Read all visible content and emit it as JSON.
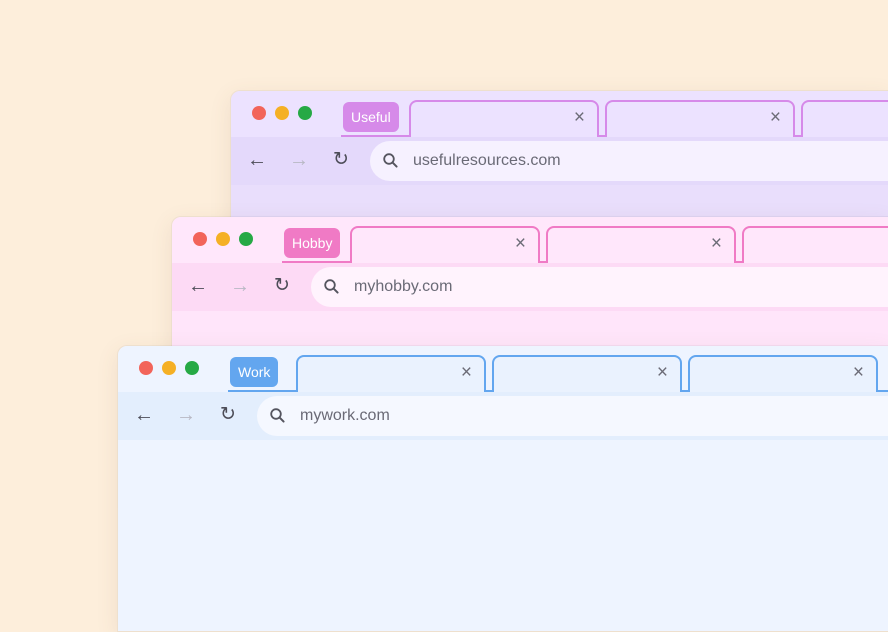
{
  "windows": {
    "useful": {
      "group_label": "Useful",
      "group_color": "#d68ae9",
      "url": "usefulresources.com",
      "tabs": [
        {
          "close": "×"
        },
        {
          "close": "×"
        },
        {
          "close": "×"
        }
      ]
    },
    "hobby": {
      "group_label": "Hobby",
      "group_color": "#f07ac5",
      "url": "myhobby.com",
      "tabs": [
        {
          "close": "×"
        },
        {
          "close": "×"
        },
        {
          "close": "×"
        }
      ]
    },
    "work": {
      "group_label": "Work",
      "group_color": "#63a6ef",
      "url": "mywork.com",
      "tabs": [
        {
          "close": "×"
        },
        {
          "close": "×"
        },
        {
          "close": "×"
        }
      ]
    }
  },
  "toolbar": {
    "back_glyph": "←",
    "forward_glyph": "→",
    "reload_glyph": "↻"
  },
  "colors": {
    "background": "#fdeedb",
    "traffic_red": "#f2645a",
    "traffic_yellow": "#f5b025",
    "traffic_green": "#26a945"
  },
  "icons": [
    "close-icon",
    "back-arrow-icon",
    "forward-arrow-icon",
    "reload-icon",
    "search-icon"
  ]
}
